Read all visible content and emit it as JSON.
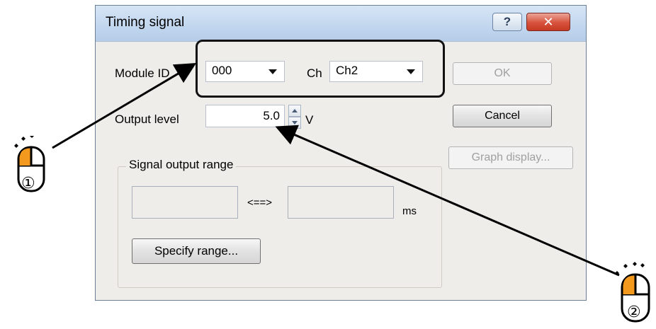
{
  "window": {
    "title": "Timing signal",
    "help_glyph": "?",
    "close_glyph": "✕"
  },
  "fields": {
    "module_id_label": "Module ID",
    "module_id_value": "000",
    "ch_label": "Ch",
    "ch_value": "Ch2",
    "output_level_label": "Output level",
    "output_level_value": "5.0",
    "output_level_unit": "V"
  },
  "buttons": {
    "ok": "OK",
    "cancel": "Cancel",
    "graph_display": "Graph display...",
    "specify_range": "Specify range..."
  },
  "signal_range": {
    "group_label": "Signal output range",
    "separator": "<==>",
    "unit": "ms",
    "start_value": "",
    "end_value": ""
  },
  "annotations": {
    "step1": "①",
    "step2": "②"
  },
  "colors": {
    "mouse_button_highlight": "#f39a1e",
    "titlebar": "#c1d6ee",
    "close_button": "#d7523d"
  },
  "icons": {
    "help": "question-icon",
    "close": "close-icon",
    "dropdown": "chevron-down-icon",
    "mouse": "mouse-icon"
  }
}
